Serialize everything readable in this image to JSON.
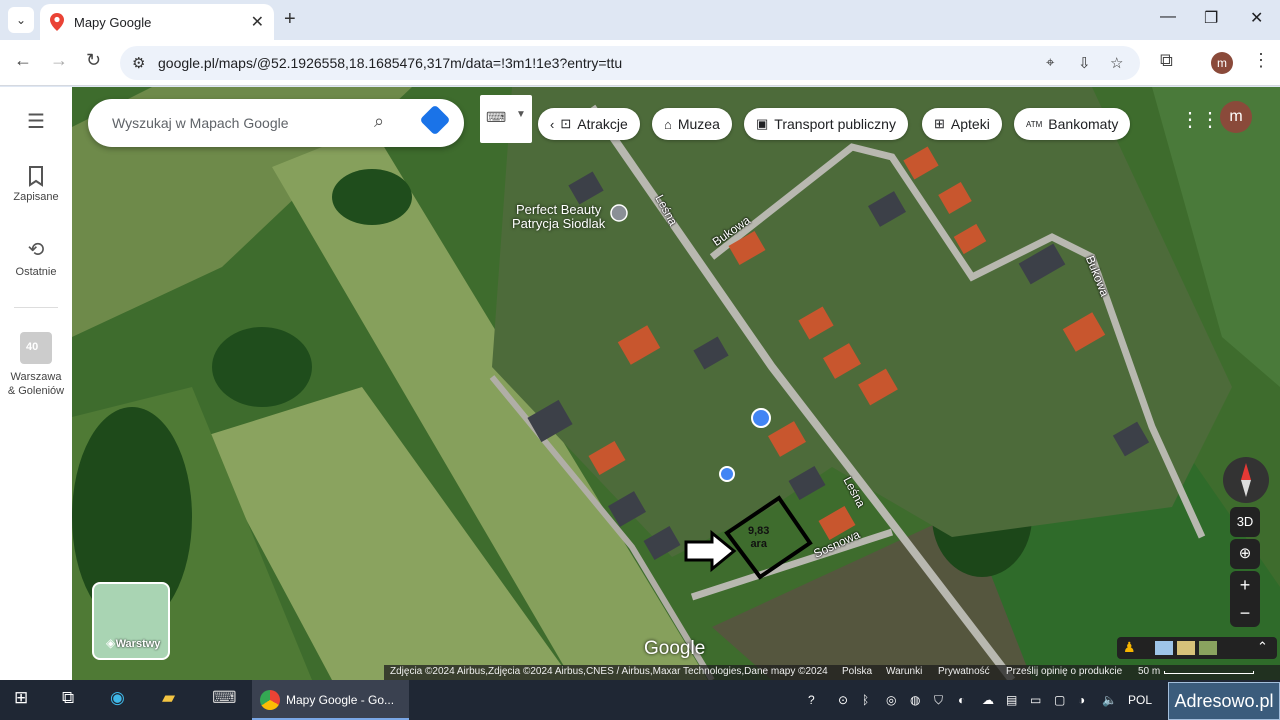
{
  "browser": {
    "tab_title": "Mapy Google",
    "tab_close": "✕",
    "new_tab": "+",
    "minimize": "—",
    "maximize": "❐",
    "close": "✕",
    "url": "google.pl/maps/@52.1926558,18.1685476,317m/data=!3m1!1e3?entry=ttu",
    "profile_letter": "m"
  },
  "sidebar": {
    "items": [
      {
        "label": "Zapisane",
        "icon": "bookmark-icon"
      },
      {
        "label": "Ostatnie",
        "icon": "history-icon"
      },
      {
        "label": "Warszawa\n& Goleniów",
        "icon": "recent-map-thumb"
      }
    ],
    "thumb_badge": "40"
  },
  "search": {
    "placeholder": "Wyszukaj w Mapach Google"
  },
  "chips": [
    {
      "label": "Atrakcje",
      "icon": "attraction-icon"
    },
    {
      "label": "Muzea",
      "icon": "museum-icon"
    },
    {
      "label": "Transport publiczny",
      "icon": "bus-icon"
    },
    {
      "label": "Apteki",
      "icon": "pharmacy-icon"
    },
    {
      "label": "Bankomaty",
      "icon": "atm-icon"
    }
  ],
  "chip_icon_texts": {
    "atm": "ATM"
  },
  "map": {
    "streets": {
      "lesna_top": "Leśna",
      "bukowa_left": "Bukowa",
      "bukowa_right": "Bukowa",
      "lesna_bottom": "Leśna",
      "sosnowa": "Sosnowa"
    },
    "poi": "Perfect Beauty\nPatrycja Siodlak",
    "parcel_area": "9,83\nara",
    "layers_label": "Warstwy",
    "ctrl_3d": "3D",
    "zoom_in": "+",
    "zoom_out": "−",
    "logo": "Google",
    "attribution": {
      "imagery": "Zdjęcia ©2024 Airbus,Zdjęcia ©2024 Airbus,CNES / Airbus,Maxar Technologies,Dane mapy ©2024",
      "country": "Polska",
      "terms": "Warunki",
      "privacy": "Prywatność",
      "feedback": "Prześlij opinię o produkcie",
      "scale": "50 m"
    }
  },
  "taskbar": {
    "chrome_label": "Mapy Google - Go...",
    "lang": "POL",
    "watermark": "Adresowo.pl"
  },
  "colors": {
    "field_light": "#7d9a55",
    "field_dark": "#3b6a2a",
    "road": "#b8b8b0",
    "roof": "#c8562e"
  }
}
